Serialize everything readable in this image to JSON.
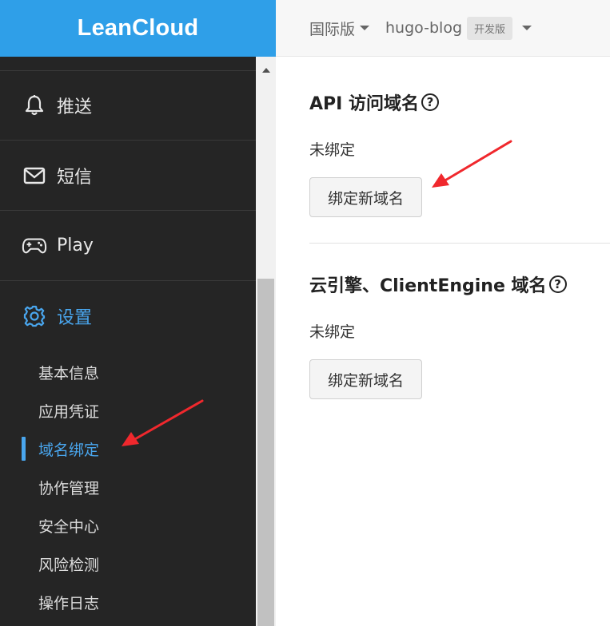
{
  "sidebar": {
    "brand": "LeanCloud",
    "items": [
      {
        "label": "推送",
        "icon": "bell-icon"
      },
      {
        "label": "短信",
        "icon": "envelope-icon"
      },
      {
        "label": "Play",
        "icon": "gamepad-icon"
      },
      {
        "label": "设置",
        "icon": "gear-icon",
        "active": true
      }
    ],
    "sub_items": [
      {
        "label": "基本信息"
      },
      {
        "label": "应用凭证"
      },
      {
        "label": "域名绑定",
        "current": true
      },
      {
        "label": "协作管理"
      },
      {
        "label": "安全中心"
      },
      {
        "label": "风险检测"
      },
      {
        "label": "操作日志"
      }
    ]
  },
  "topbar": {
    "region": "国际版",
    "app_name": "hugo-blog",
    "env_badge": "开发版"
  },
  "main": {
    "sections": [
      {
        "title": "API 访问域名",
        "status": "未绑定",
        "button": "绑定新域名"
      },
      {
        "title": "云引擎、ClientEngine 域名",
        "status": "未绑定",
        "button": "绑定新域名"
      }
    ]
  },
  "colors": {
    "brand_blue": "#2f9fe8",
    "sidebar_bg": "#252525",
    "active_blue": "#49a6ee",
    "annotation_red": "#f0282d"
  }
}
